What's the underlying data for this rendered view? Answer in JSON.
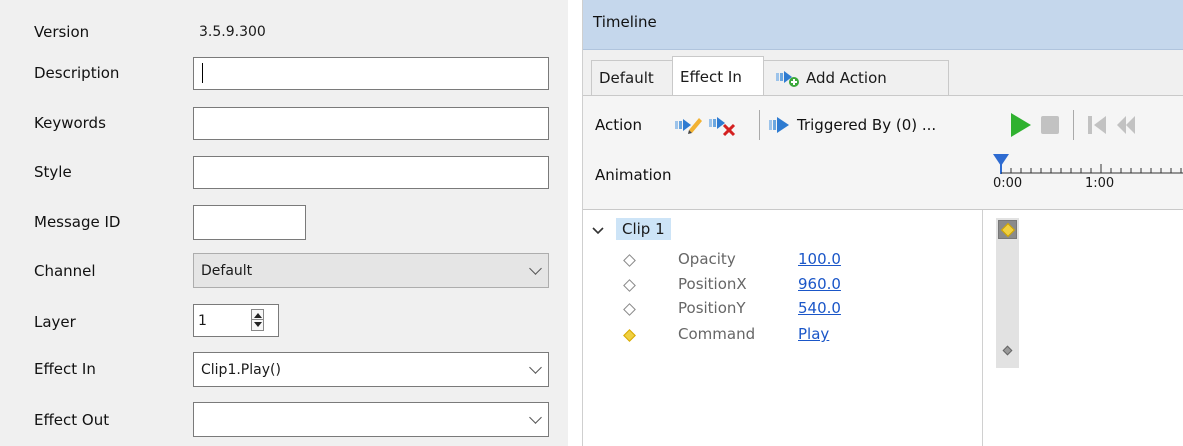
{
  "properties": {
    "version_label": "Version",
    "version_value": "3.5.9.300",
    "description_label": "Description",
    "description_value": "",
    "keywords_label": "Keywords",
    "keywords_value": "",
    "style_label": "Style",
    "style_value": "",
    "message_id_label": "Message ID",
    "message_id_value": "",
    "channel_label": "Channel",
    "channel_value": "Default",
    "layer_label": "Layer",
    "layer_value": "1",
    "effect_in_label": "Effect In",
    "effect_in_value": "Clip1.Play()",
    "effect_out_label": "Effect Out",
    "effect_out_value": ""
  },
  "timeline": {
    "title": "Timeline",
    "tabs": [
      {
        "label": "Default"
      },
      {
        "label": "Effect In"
      },
      {
        "label": "Add Action"
      }
    ],
    "toolbar": {
      "action_label": "Action",
      "triggered_by_label": "Triggered By (0) ...",
      "animation_label": "Animation",
      "ruler_ticks": [
        "0:00",
        "1:00"
      ]
    },
    "tree": {
      "clip_label": "Clip 1",
      "properties": [
        {
          "name": "Opacity",
          "value": "100.0"
        },
        {
          "name": "PositionX",
          "value": "960.0"
        },
        {
          "name": "PositionY",
          "value": "540.0"
        },
        {
          "name": "Command",
          "value": "Play"
        }
      ]
    },
    "colors": {
      "title_bar": "#c5d7ec",
      "play_green": "#2fb12f",
      "key_yellow": "#f0d040",
      "link_blue": "#1a56c8"
    }
  }
}
